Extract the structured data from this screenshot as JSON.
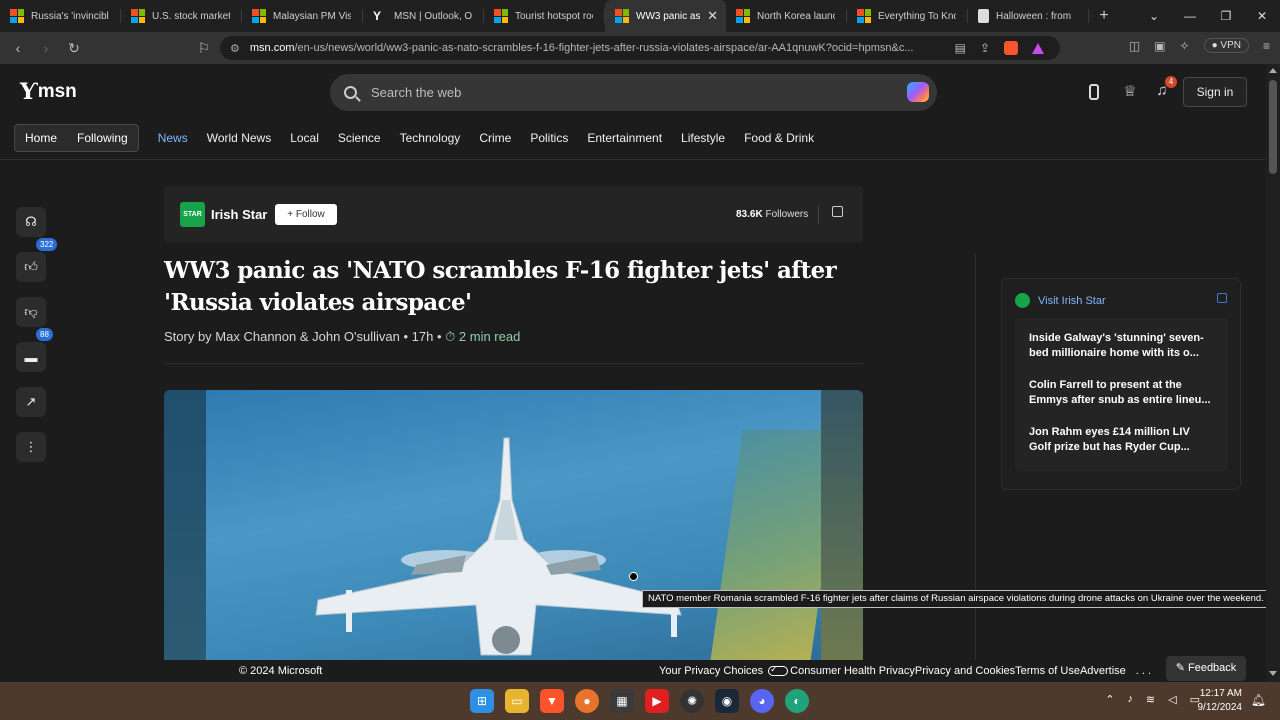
{
  "browser": {
    "tabs": [
      {
        "label": "Russia's 'invincible",
        "icon": "ms"
      },
      {
        "label": "U.S. stock market l",
        "icon": "ms"
      },
      {
        "label": "Malaysian PM Visit",
        "icon": "ms"
      },
      {
        "label": "MSN | Outlook, Off",
        "icon": "msn"
      },
      {
        "label": "Tourist hotspot roc",
        "icon": "ms"
      },
      {
        "label": "WW3 panic as",
        "icon": "ms",
        "active": true
      },
      {
        "label": "North Korea launc",
        "icon": "ms"
      },
      {
        "label": "Everything To Know",
        "icon": "ms"
      },
      {
        "label": "Halloween : from p",
        "icon": "doc"
      }
    ],
    "url_domain": "msn.com",
    "url_path": "/en-us/news/world/ww3-panic-as-nato-scrambles-f-16-fighter-jets-after-russia-violates-airspace/ar-AA1qnuwK?ocid=hpmsn&c...",
    "vpn_label": "VPN"
  },
  "msn": {
    "logo_text": "msn",
    "search_placeholder": "Search the web",
    "notification_count": "4",
    "sign_in": "Sign in",
    "nav_pills": [
      "Home",
      "Following"
    ],
    "nav_links": [
      "News",
      "World News",
      "Local",
      "Science",
      "Technology",
      "Crime",
      "Politics",
      "Entertainment",
      "Lifestyle",
      "Food & Drink"
    ],
    "active_nav": "News"
  },
  "rail": {
    "likes_count": "322",
    "comments_count": "88"
  },
  "article": {
    "source_name": "Irish Star",
    "source_logo_text": "STAR",
    "follow_label": "Follow",
    "followers_count": "83.6K",
    "followers_label": "Followers",
    "title": "WW3 panic as 'NATO scrambles F-16 fighter jets' after 'Russia violates airspace'",
    "byline": "Story by Max Channon & John O'sullivan • 17h •",
    "read_time": "2 min read",
    "image_caption": "NATO member Romania scrambled F-16 fighter jets after claims of Russian airspace violations during drone attacks on Ukraine over the weekend."
  },
  "sidebar": {
    "visit_label": "Visit Irish Star",
    "items": [
      "Inside Galway's 'stunning' seven-bed millionaire home with its o...",
      "Colin Farrell to present at the Emmys after snub as entire lineu...",
      "Jon Rahm eyes £14 million LIV Golf prize but has Ryder Cup..."
    ]
  },
  "footer": {
    "copyright": "© 2024 Microsoft",
    "privacy_choices": "Your Privacy Choices",
    "links": [
      "Consumer Health Privacy",
      "Privacy and Cookies",
      "Terms of Use",
      "Advertise"
    ],
    "more": ". . .",
    "feedback": "Feedback"
  },
  "taskbar": {
    "time": "12:17 AM",
    "date": "9/12/2024"
  }
}
